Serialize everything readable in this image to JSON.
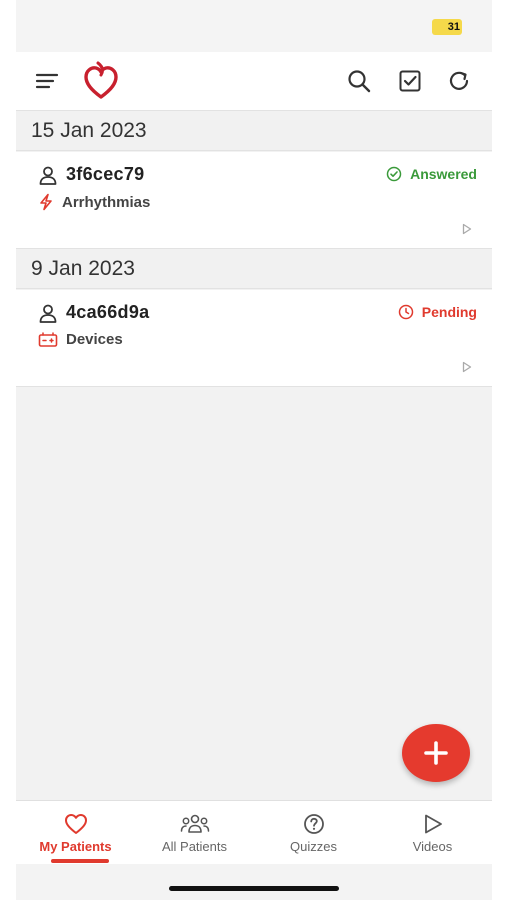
{
  "status_bar": {
    "battery": "31"
  },
  "header": {
    "menu_icon": "menu-icon",
    "logo": "heart-logo",
    "actions": [
      "search-icon",
      "checkbox-icon",
      "refresh-icon"
    ]
  },
  "groups": [
    {
      "date": "15 Jan 2023",
      "patient": {
        "id": "3f6cec79",
        "category": "Arrhythmias",
        "category_icon": "lightning-icon",
        "status": "Answered",
        "status_color": "#3a9a3a"
      }
    },
    {
      "date": "9 Jan 2023",
      "patient": {
        "id": "4ca66d9a",
        "category": "Devices",
        "category_icon": "battery-device-icon",
        "status": "Pending",
        "status_color": "#e03a2e"
      }
    }
  ],
  "fab": {
    "icon": "plus-icon"
  },
  "tabs": [
    {
      "label": "My Patients",
      "icon": "heart-icon",
      "active": true
    },
    {
      "label": "All Patients",
      "icon": "group-icon",
      "active": false
    },
    {
      "label": "Quizzes",
      "icon": "question-icon",
      "active": false
    },
    {
      "label": "Videos",
      "icon": "play-icon",
      "active": false
    }
  ],
  "colors": {
    "accent": "#e53a2e",
    "answered": "#3a9a3a",
    "pending": "#e03a2e"
  }
}
